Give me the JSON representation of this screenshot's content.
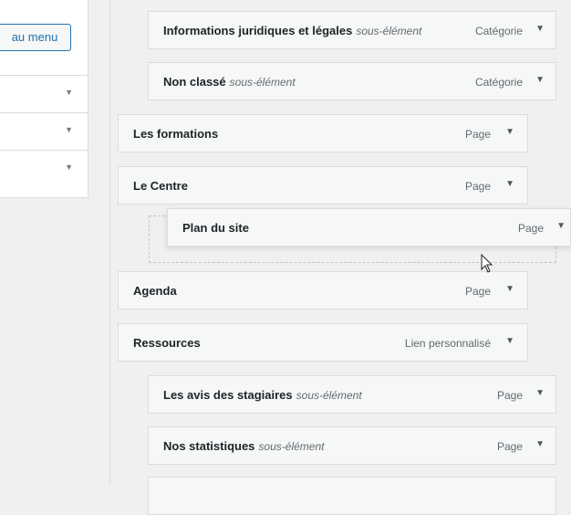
{
  "left": {
    "add_button": "au menu",
    "rows": [
      "",
      "",
      ""
    ]
  },
  "menu": {
    "items": [
      {
        "title": "Informations juridiques et légales",
        "sub": "sous-élément",
        "type": "Catégorie"
      },
      {
        "title": "Non classé",
        "sub": "sous-élément",
        "type": "Catégorie"
      },
      {
        "title": "Les formations",
        "sub": "",
        "type": "Page"
      },
      {
        "title": "Le Centre",
        "sub": "",
        "type": "Page"
      },
      {
        "title": "Plan du site",
        "sub": "",
        "type": "Page"
      },
      {
        "title": "Agenda",
        "sub": "",
        "type": "Page"
      },
      {
        "title": "Ressources",
        "sub": "",
        "type": "Lien personnalisé"
      },
      {
        "title": "Les avis des stagiaires",
        "sub": "sous-élément",
        "type": "Page"
      },
      {
        "title": "Nos statistiques",
        "sub": "sous-élément",
        "type": "Page"
      }
    ],
    "arrow_glyph": "▼"
  },
  "icons": {
    "caret": "chevron-down-icon",
    "cursor": "mouse-pointer-icon"
  }
}
